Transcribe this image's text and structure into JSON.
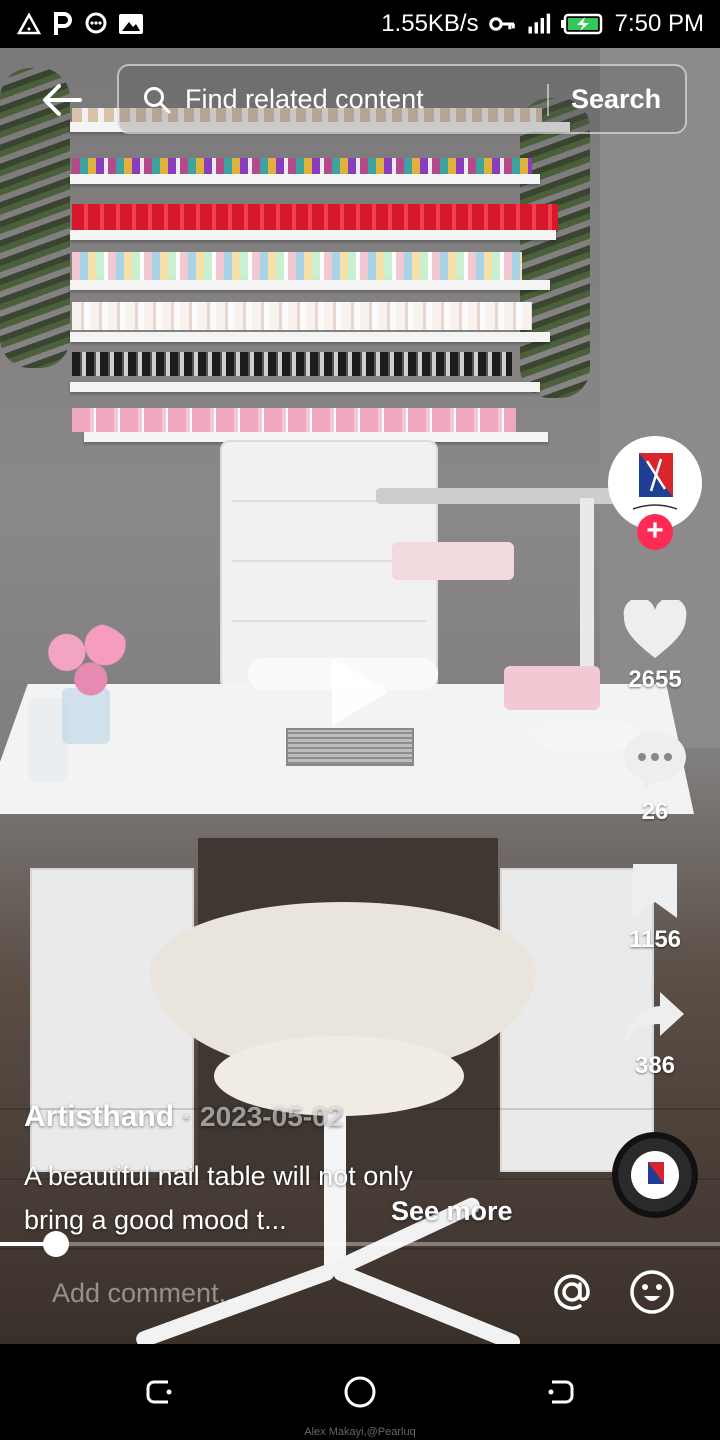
{
  "status_bar": {
    "network_speed": "1.55KB/s",
    "time": "7:50 PM",
    "left_icons": [
      "warning-icon",
      "parking-icon",
      "message-icon",
      "image-icon"
    ],
    "right_icons": [
      "key-icon",
      "signal-icon",
      "battery-charging-icon"
    ]
  },
  "search": {
    "placeholder": "Find related content",
    "button_label": "Search"
  },
  "video": {
    "state": "paused"
  },
  "actions": {
    "likes": "2655",
    "comments": "26",
    "saves": "1156",
    "shares": "386"
  },
  "post": {
    "author": "Artisthand",
    "date_separator": "·",
    "date": "2023-05-02",
    "caption_line1": "A beautiful nail table will not only",
    "caption_line2": "bring a good mood t...",
    "see_more_label": "See more"
  },
  "progress": {
    "fraction": 0.078
  },
  "comment": {
    "placeholder": "Add comment..."
  },
  "watermark": "Alex Makayi,@Pearluq",
  "colors": {
    "accent": "#fe2c55",
    "background": "#000000"
  }
}
